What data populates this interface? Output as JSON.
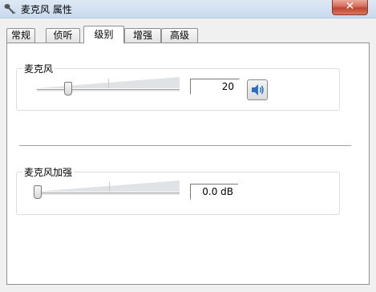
{
  "window": {
    "title": "麦克风 属性",
    "close_label": "✕",
    "title_icon": "microphone-icon"
  },
  "tabs": [
    {
      "label": "常规",
      "active": false
    },
    {
      "label": "侦听",
      "active": false
    },
    {
      "label": "级别",
      "active": true
    },
    {
      "label": "增强",
      "active": false
    },
    {
      "label": "高级",
      "active": false
    }
  ],
  "levels": {
    "microphone": {
      "label": "麦克风",
      "value": "20",
      "level": 0.2,
      "mute_button_icon": "speaker-icon"
    },
    "boost": {
      "label": "麦克风加强",
      "value": "0.0 dB",
      "level": 0
    }
  }
}
